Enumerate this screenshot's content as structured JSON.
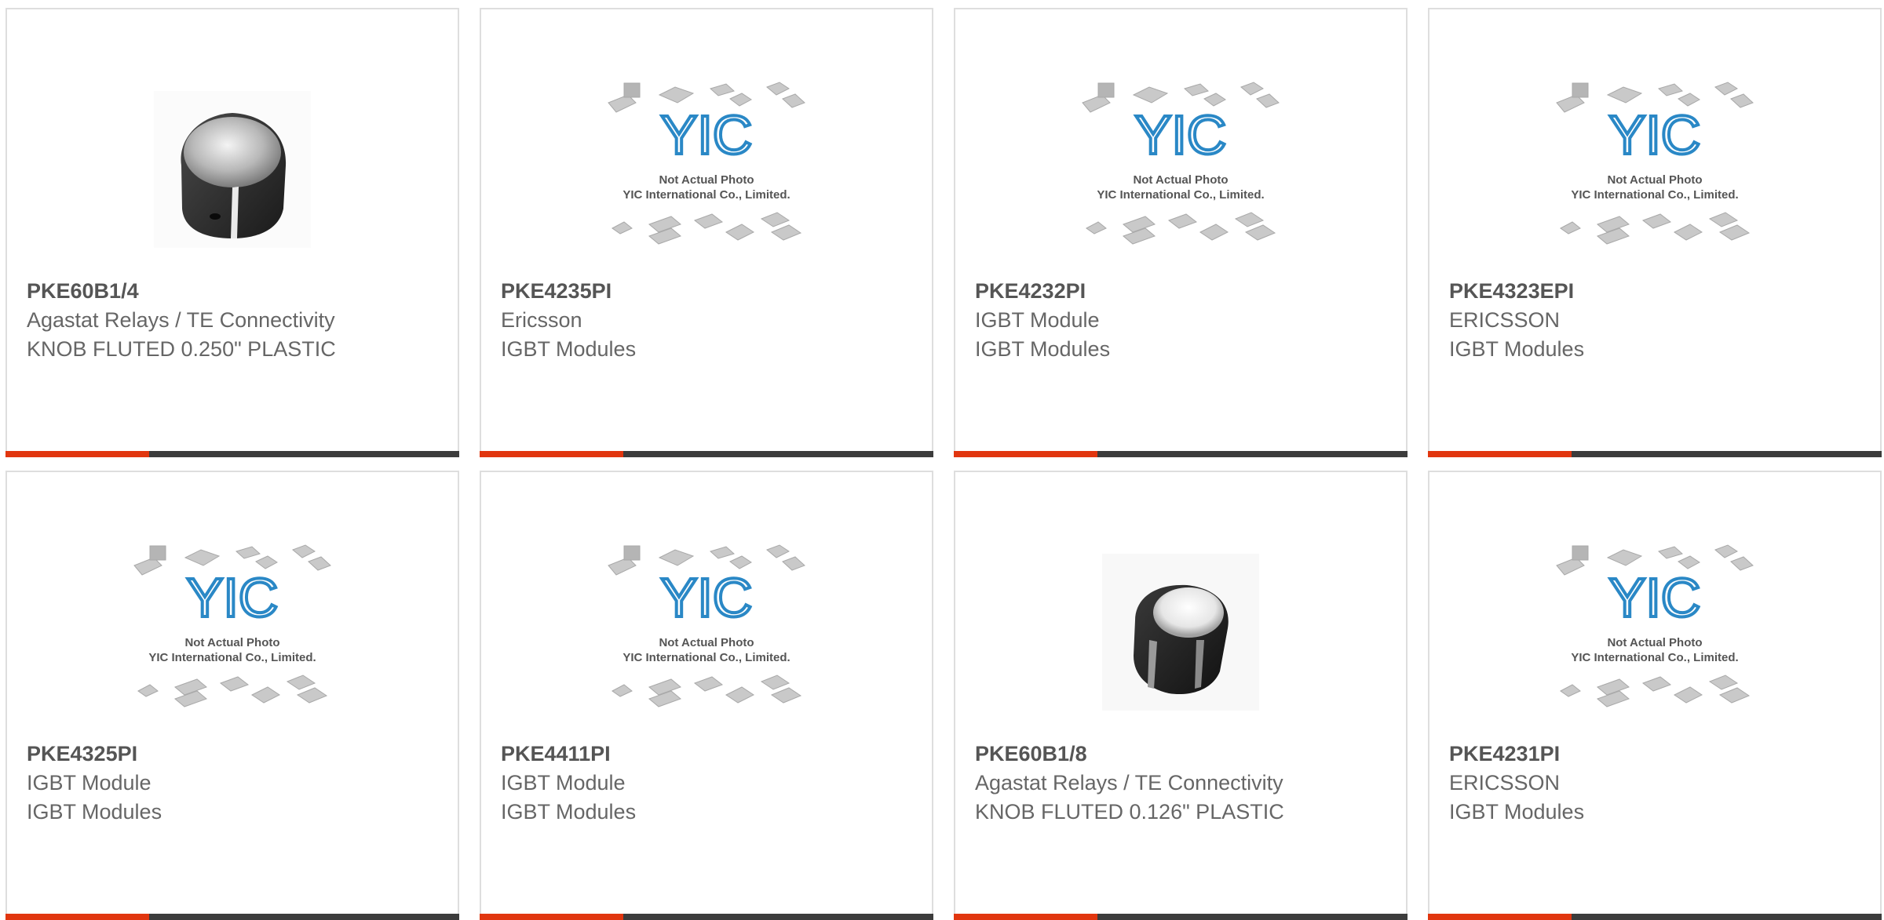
{
  "placeholder": {
    "line1": "Not Actual Photo",
    "line2": "YIC International Co., Limited.",
    "logo": "YIC"
  },
  "products": [
    {
      "part": "PKE60B1/4",
      "maker": "Agastat Relays / TE Connectivity",
      "desc": "KNOB FLUTED 0.250\" PLASTIC",
      "image": "knob-large"
    },
    {
      "part": "PKE4235PI",
      "maker": "Ericsson",
      "desc": "IGBT Modules",
      "image": "placeholder"
    },
    {
      "part": "PKE4232PI",
      "maker": "IGBT Module",
      "desc": "IGBT Modules",
      "image": "placeholder"
    },
    {
      "part": "PKE4323EPI",
      "maker": "ERICSSON",
      "desc": "IGBT Modules",
      "image": "placeholder"
    },
    {
      "part": "PKE4325PI",
      "maker": "IGBT Module",
      "desc": "IGBT Modules",
      "image": "placeholder"
    },
    {
      "part": "PKE4411PI",
      "maker": "IGBT Module",
      "desc": "IGBT Modules",
      "image": "placeholder"
    },
    {
      "part": "PKE60B1/8",
      "maker": "Agastat Relays / TE Connectivity",
      "desc": "KNOB FLUTED 0.126\" PLASTIC",
      "image": "knob-small"
    },
    {
      "part": "PKE4231PI",
      "maker": "ERICSSON",
      "desc": "IGBT Modules",
      "image": "placeholder"
    }
  ],
  "colors": {
    "accent": "#e1360f",
    "bar": "#3c3c3c",
    "border": "#dedede",
    "text": "#666666"
  }
}
